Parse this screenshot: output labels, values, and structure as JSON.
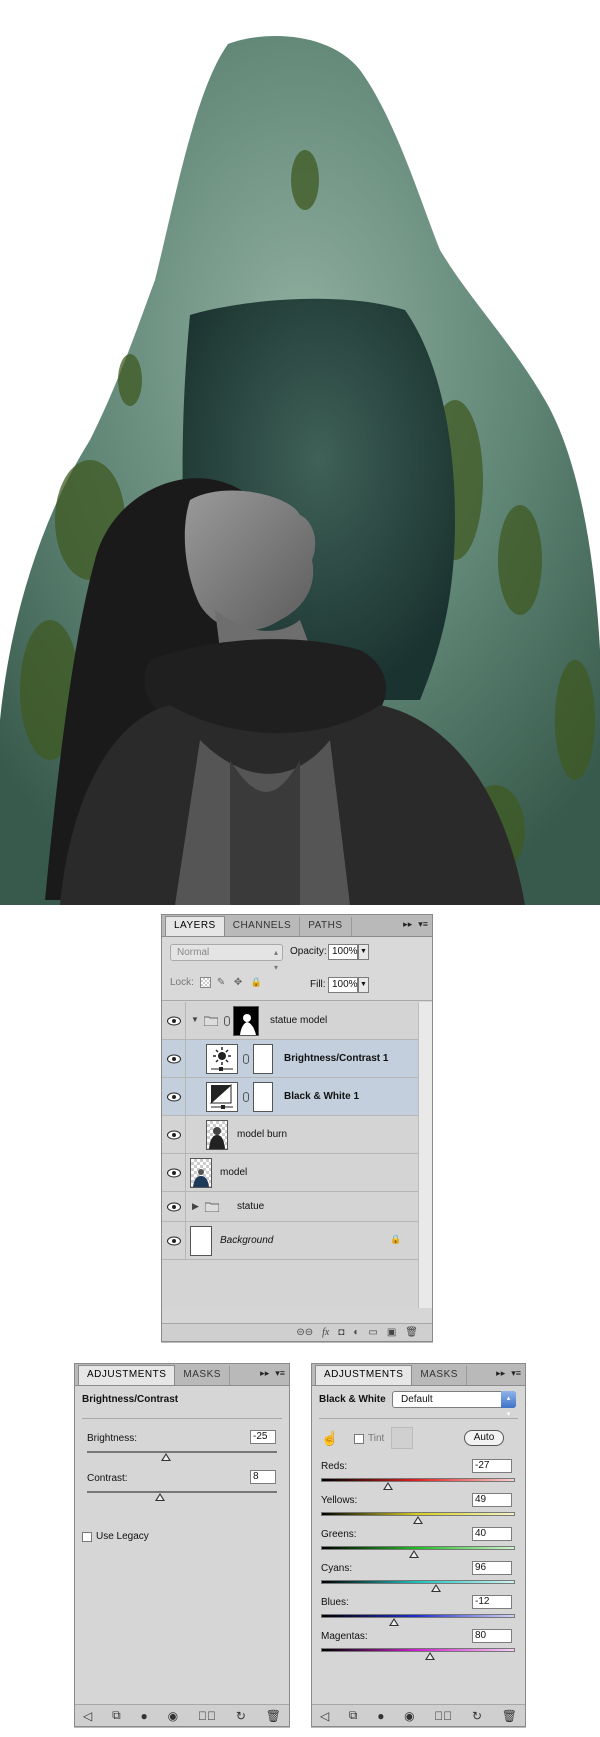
{
  "layers_panel": {
    "tabs": [
      "LAYERS",
      "CHANNELS",
      "PATHS"
    ],
    "menu_glyphs": [
      "▸▸",
      "▾≡"
    ],
    "blend_mode": "Normal",
    "opacity_label": "Opacity:",
    "opacity_value": "100%",
    "lock_label": "Lock:",
    "fill_label": "Fill:",
    "fill_value": "100%",
    "layers": [
      {
        "name": "statue model",
        "type": "group-open",
        "selected": false
      },
      {
        "name": "Brightness/Contrast 1",
        "type": "adjustment",
        "selected": true
      },
      {
        "name": "Black & White 1",
        "type": "adjustment",
        "selected": true
      },
      {
        "name": "model burn",
        "type": "pixel",
        "selected": false
      },
      {
        "name": "model",
        "type": "pixel",
        "selected": false
      },
      {
        "name": "statue",
        "type": "group-closed",
        "selected": false
      },
      {
        "name": "Background",
        "type": "background",
        "selected": false
      }
    ],
    "footer_glyphs": [
      "⊝⊝",
      "fx",
      "◘",
      "◐",
      "▭",
      "▣",
      "🗑"
    ]
  },
  "brightness_contrast_panel": {
    "tabs": [
      "ADJUSTMENTS",
      "MASKS"
    ],
    "menu_glyphs": [
      "▸▸",
      "▾≡"
    ],
    "title": "Brightness/Contrast",
    "brightness_label": "Brightness:",
    "brightness_value": "-25",
    "contrast_label": "Contrast:",
    "contrast_value": "8",
    "legacy_label": "Use Legacy",
    "legacy_checked": false,
    "brightness_level": -25,
    "brightness_range": [
      -150,
      150
    ],
    "contrast_level": 8,
    "contrast_range": [
      -50,
      100
    ],
    "footer_glyphs": [
      "◁",
      "⧉",
      "●",
      "◉",
      "↺⃝",
      "↻",
      "🗑"
    ]
  },
  "black_white_panel": {
    "tabs": [
      "ADJUSTMENTS",
      "MASKS"
    ],
    "menu_glyphs": [
      "▸▸",
      "▾≡"
    ],
    "title": "Black & White",
    "preset": "Default",
    "tint_label": "Tint",
    "tint_checked": false,
    "auto_label": "Auto",
    "sliders": [
      {
        "label": "Reds:",
        "value": "-27",
        "level": -27,
        "gradient": [
          "#000000",
          "#e62020",
          "#f5d0d0"
        ]
      },
      {
        "label": "Yellows:",
        "value": "49",
        "level": 49,
        "gradient": [
          "#000000",
          "#d8d020",
          "#f5f3c8"
        ]
      },
      {
        "label": "Greens:",
        "value": "40",
        "level": 40,
        "gradient": [
          "#000000",
          "#20c020",
          "#d0f5d0"
        ]
      },
      {
        "label": "Cyans:",
        "value": "96",
        "level": 96,
        "gradient": [
          "#000000",
          "#20c0c0",
          "#d0f5f5"
        ]
      },
      {
        "label": "Blues:",
        "value": "-12",
        "level": -12,
        "gradient": [
          "#000000",
          "#2030d0",
          "#d0d4f5"
        ]
      },
      {
        "label": "Magentas:",
        "value": "80",
        "level": 80,
        "gradient": [
          "#000000",
          "#d020d0",
          "#f5d0f5"
        ]
      }
    ],
    "slider_range": [
      -200,
      300
    ],
    "footer_glyphs": [
      "◁",
      "⧉",
      "●",
      "◉",
      "↺⃝",
      "↻",
      "🗑"
    ]
  },
  "colors": {
    "panel_bg": "#d6d6d6",
    "selected_row": "#c3cfdc",
    "statue_green": "#4f7766",
    "moss": "#3f5a22"
  }
}
